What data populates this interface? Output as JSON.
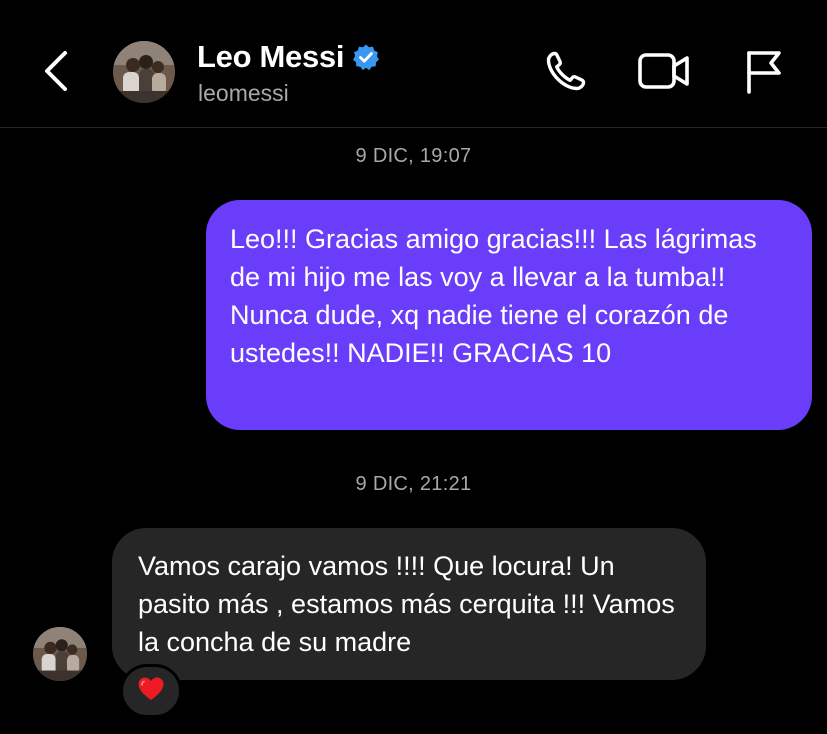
{
  "header": {
    "contact_name": "Leo Messi",
    "username": "leomessi",
    "verified": true,
    "icons": {
      "back": "chevron-left-icon",
      "call": "phone-icon",
      "video": "video-camera-icon",
      "report": "flag-icon"
    }
  },
  "conversation": {
    "messages": [
      {
        "timestamp": "9 DIC, 19:07",
        "direction": "outgoing",
        "text": "Leo!!! Gracias amigo gracias!!! Las lágrimas de mi hijo me las voy a llevar a la tumba!! Nunca dude, xq nadie tiene el corazón de ustedes!! NADIE!! GRACIAS 10"
      },
      {
        "timestamp": "9 DIC, 21:21",
        "direction": "incoming",
        "text": "Vamos carajo vamos !!!! Que locura! Un pasito más , estamos más cerquita !!! Vamos la concha de su madre",
        "reaction": "heart-icon"
      }
    ]
  },
  "colors": {
    "outgoing_bubble": "#6a3dfa",
    "incoming_bubble": "#262626",
    "verified_badge": "#3897f0",
    "background": "#000000",
    "secondary_text": "#a8a8a8"
  }
}
